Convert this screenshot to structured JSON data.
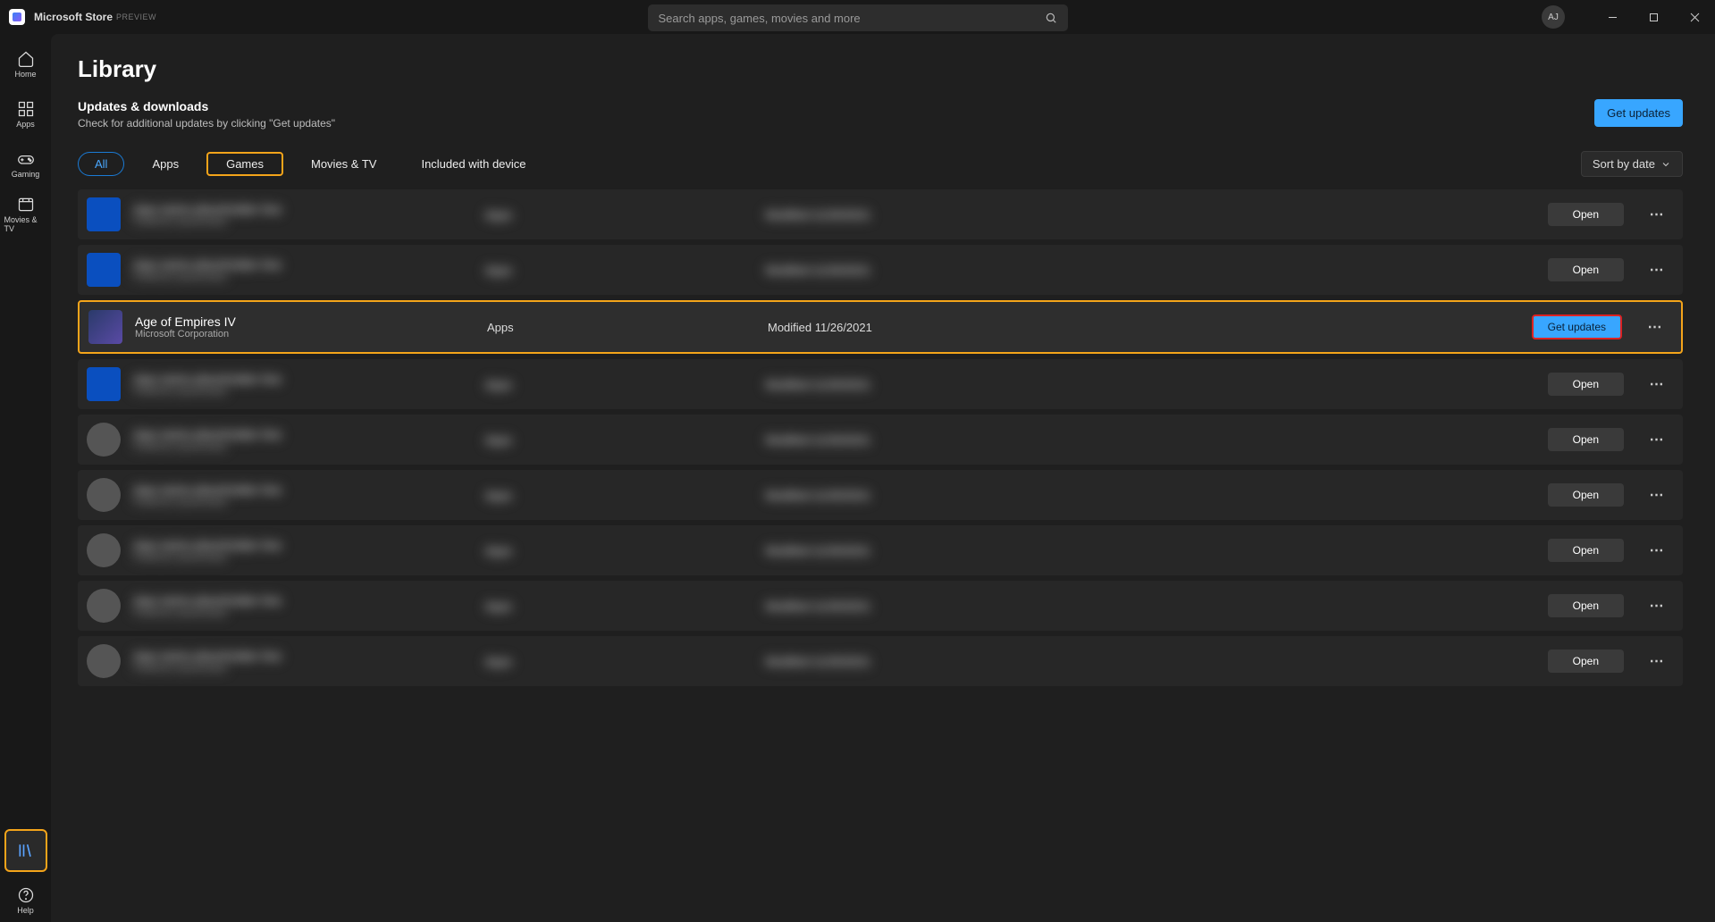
{
  "titlebar": {
    "app_name": "Microsoft Store",
    "preview_badge": "PREVIEW",
    "search_placeholder": "Search apps, games, movies and more",
    "avatar_initials": "AJ"
  },
  "sidebar": {
    "items": [
      {
        "id": "home",
        "label": "Home"
      },
      {
        "id": "apps",
        "label": "Apps"
      },
      {
        "id": "gaming",
        "label": "Gaming"
      },
      {
        "id": "movies",
        "label": "Movies & TV"
      }
    ],
    "library_label": "",
    "help_label": "Help"
  },
  "header": {
    "page_title": "Library",
    "section_title": "Updates & downloads",
    "section_subtitle": "Check for additional updates by clicking \"Get updates\"",
    "get_updates_label": "Get updates"
  },
  "filters": {
    "items": [
      {
        "id": "all",
        "label": "All"
      },
      {
        "id": "apps",
        "label": "Apps"
      },
      {
        "id": "games",
        "label": "Games"
      },
      {
        "id": "movies",
        "label": "Movies & TV"
      },
      {
        "id": "included",
        "label": "Included with device"
      }
    ],
    "sort_label": "Sort by date"
  },
  "list": {
    "open_label": "Open",
    "get_updates_label": "Get updates",
    "rows": [
      {
        "name": "",
        "publisher": "",
        "category": "",
        "modified": "",
        "action": "open",
        "blurred": true,
        "thumb": "square-blue"
      },
      {
        "name": "",
        "publisher": "",
        "category": "",
        "modified": "",
        "action": "open",
        "blurred": true,
        "thumb": "square-blue"
      },
      {
        "name": "Age of Empires IV",
        "publisher": "Microsoft Corporation",
        "category": "Apps",
        "modified": "Modified 11/26/2021",
        "action": "getupdates",
        "blurred": false,
        "thumb": "aoe",
        "selected": true
      },
      {
        "name": "",
        "publisher": "",
        "category": "",
        "modified": "",
        "action": "open",
        "blurred": true,
        "thumb": "square-blue"
      },
      {
        "name": "",
        "publisher": "",
        "category": "",
        "modified": "",
        "action": "open",
        "blurred": true,
        "thumb": "round"
      },
      {
        "name": "",
        "publisher": "",
        "category": "",
        "modified": "",
        "action": "open",
        "blurred": true,
        "thumb": "round"
      },
      {
        "name": "",
        "publisher": "",
        "category": "",
        "modified": "",
        "action": "open",
        "blurred": true,
        "thumb": "round"
      },
      {
        "name": "",
        "publisher": "",
        "category": "",
        "modified": "",
        "action": "open",
        "blurred": true,
        "thumb": "round"
      },
      {
        "name": "",
        "publisher": "",
        "category": "",
        "modified": "",
        "action": "open",
        "blurred": true,
        "thumb": "round"
      }
    ]
  }
}
